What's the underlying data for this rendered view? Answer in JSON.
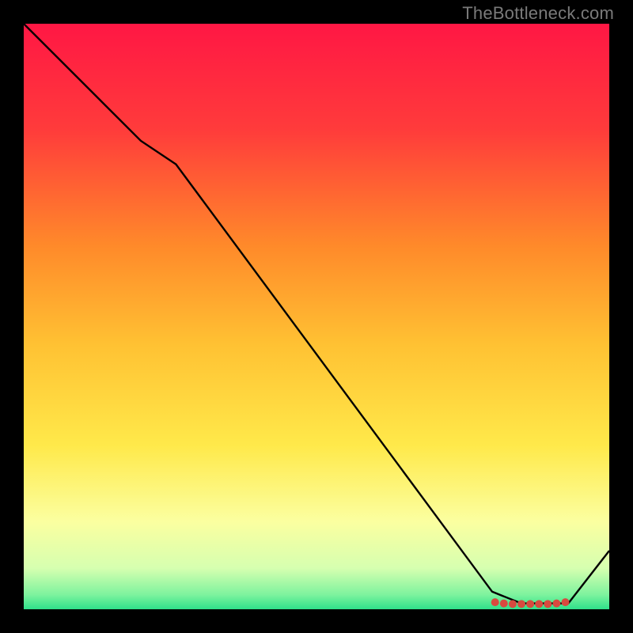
{
  "watermark": "TheBottleneck.com",
  "chart_data": {
    "type": "line",
    "title": "",
    "xlabel": "",
    "ylabel": "",
    "xlim": [
      0,
      100
    ],
    "ylim": [
      0,
      100
    ],
    "grid": false,
    "legend": false,
    "background_gradient": {
      "stops": [
        {
          "offset": 0.0,
          "color": "#ff1744"
        },
        {
          "offset": 0.18,
          "color": "#ff3b3b"
        },
        {
          "offset": 0.38,
          "color": "#ff8a2a"
        },
        {
          "offset": 0.55,
          "color": "#ffc233"
        },
        {
          "offset": 0.72,
          "color": "#ffe94a"
        },
        {
          "offset": 0.85,
          "color": "#fbffa0"
        },
        {
          "offset": 0.93,
          "color": "#d6ffb0"
        },
        {
          "offset": 0.975,
          "color": "#7ef39e"
        },
        {
          "offset": 1.0,
          "color": "#2fe08a"
        }
      ]
    },
    "series": [
      {
        "name": "curve",
        "color": "#000000",
        "stroke_width": 2.4,
        "x": [
          0,
          20,
          26,
          80,
          85,
          90,
          93,
          100
        ],
        "y": [
          100,
          80,
          76,
          3,
          1,
          1,
          1,
          10
        ]
      }
    ],
    "markers": {
      "name": "optimal-zone",
      "color": "#d84a3f",
      "radius": 5.0,
      "x": [
        80.5,
        82.0,
        83.5,
        85.0,
        86.5,
        88.0,
        89.5,
        91.0,
        92.5
      ],
      "y": [
        1.2,
        1.0,
        0.9,
        0.9,
        0.9,
        0.9,
        0.9,
        1.0,
        1.2
      ]
    }
  }
}
